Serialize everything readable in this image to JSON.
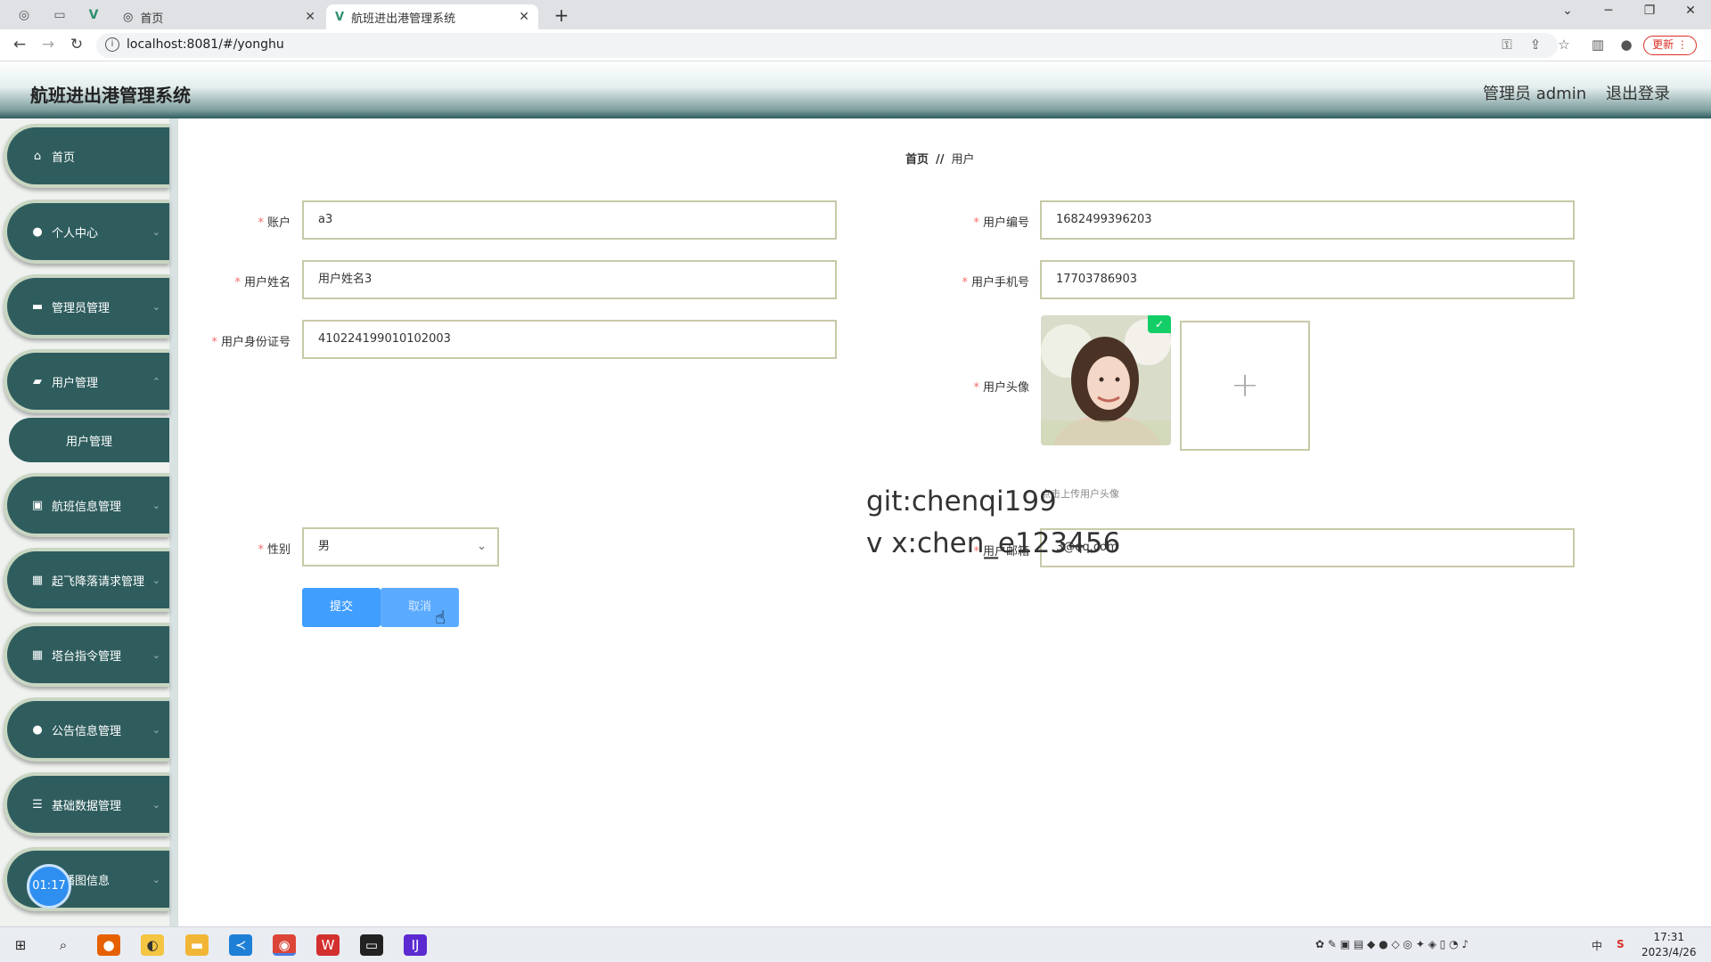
{
  "browser": {
    "tabs": [
      {
        "title": "首页"
      },
      {
        "title": "航班进出港管理系统"
      }
    ],
    "url": "localhost:8081/#/yonghu",
    "update_label": "更新"
  },
  "header": {
    "app_title": "航班进出港管理系统",
    "user_label": "管理员 admin",
    "logout_label": "退出登录"
  },
  "sidebar": {
    "items": [
      {
        "label": "首页",
        "icon": "home-icon"
      },
      {
        "label": "个人中心",
        "icon": "person-icon"
      },
      {
        "label": "管理员管理",
        "icon": "chat-icon"
      },
      {
        "label": "用户管理",
        "icon": "ticket-icon"
      },
      {
        "label": "航班信息管理",
        "icon": "clipboard-icon"
      },
      {
        "label": "起飞降落请求管理",
        "icon": "grid-icon"
      },
      {
        "label": "塔台指令管理",
        "icon": "grid-icon"
      },
      {
        "label": "公告信息管理",
        "icon": "bulb-icon"
      },
      {
        "label": "基础数据管理",
        "icon": "list-icon"
      },
      {
        "label": "轮播图信息",
        "icon": "image-icon"
      }
    ],
    "submenu_label": "用户管理",
    "timer": "01:17"
  },
  "breadcrumb": {
    "home": "首页",
    "sep": "//",
    "current": "用户"
  },
  "form": {
    "account": {
      "label": "账户",
      "value": "a3"
    },
    "name": {
      "label": "用户姓名",
      "value": "用户姓名3"
    },
    "idcard": {
      "label": "用户身份证号",
      "value": "410224199010102003"
    },
    "gender": {
      "label": "性别",
      "value": "男"
    },
    "user_no": {
      "label": "用户编号",
      "value": "1682499396203"
    },
    "phone": {
      "label": "用户手机号",
      "value": "17703786903"
    },
    "avatar": {
      "label": "用户头像",
      "tip": "点击上传用户头像"
    },
    "email": {
      "label": "用户邮箱",
      "value": "3@qq.com"
    }
  },
  "buttons": {
    "submit": "提交",
    "cancel": "取消"
  },
  "watermark": {
    "line1": "git:chenqi199",
    "line2": "v x:chen_e123456"
  },
  "taskbar": {
    "time": "17:31",
    "date": "2023/4/26",
    "ime": "中"
  },
  "colors": {
    "brand": "#2f5d5e",
    "primary": "#409eff",
    "required": "#f56c6c",
    "success": "#13ce66"
  }
}
